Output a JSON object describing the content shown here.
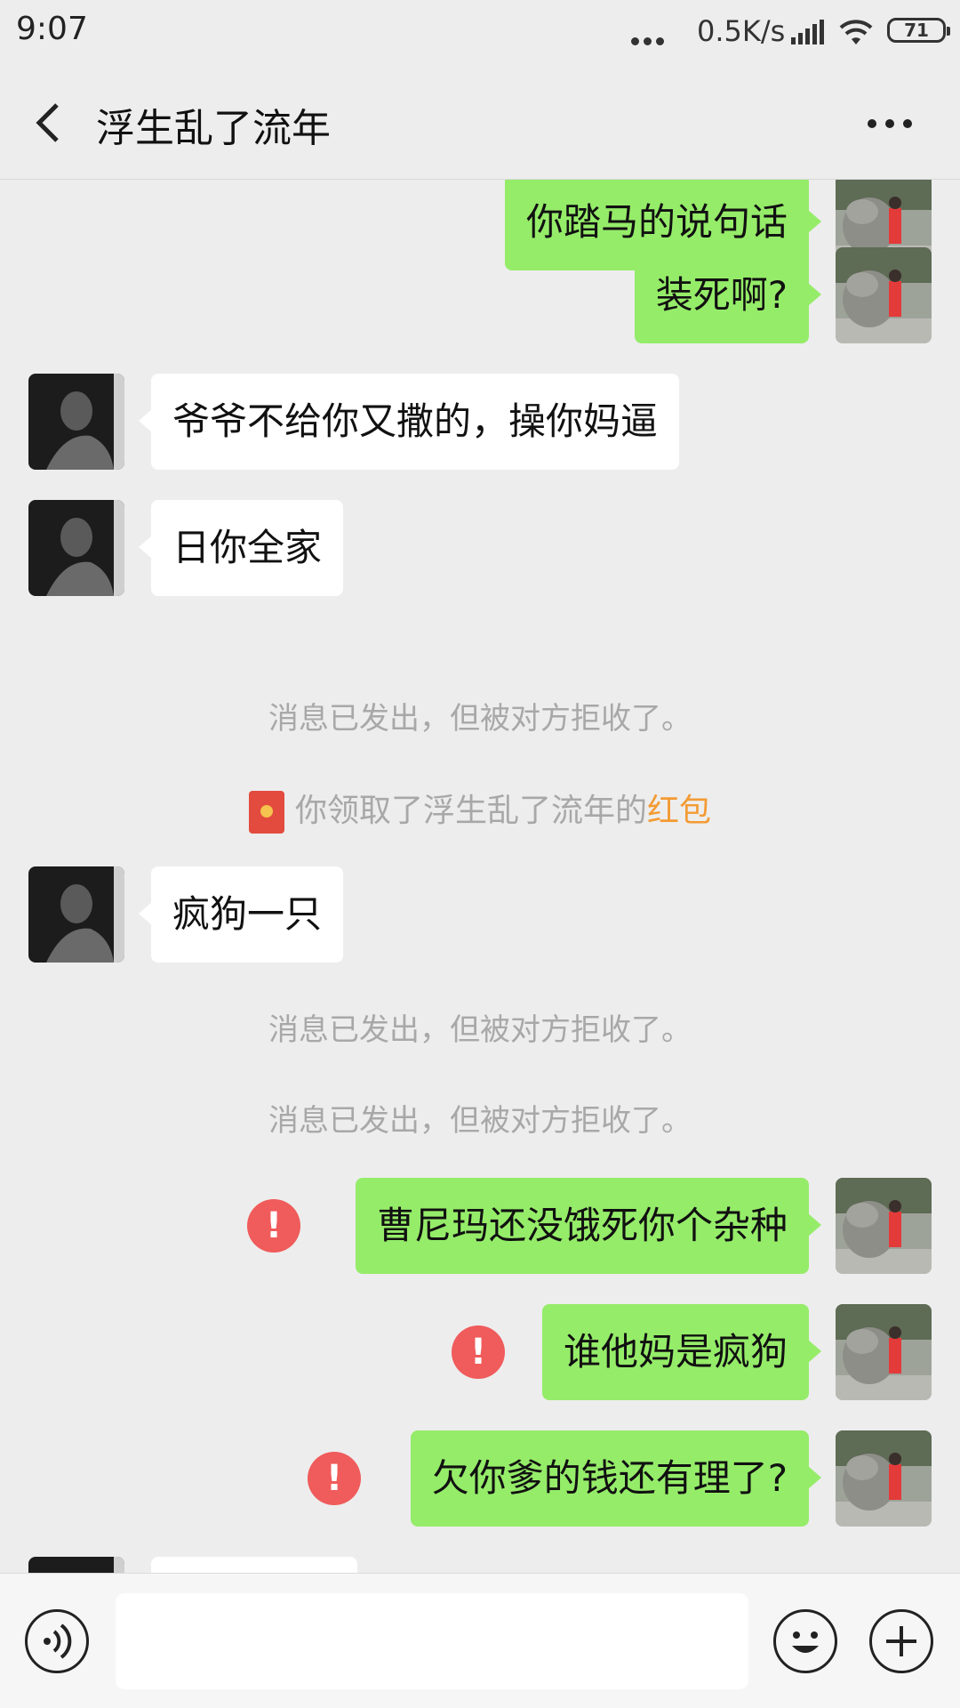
{
  "status_bar": {
    "time": "9:07",
    "network_speed": "0.5K/s",
    "battery": "71",
    "icons": [
      "more-dots-icon",
      "signal-icon",
      "wifi-icon",
      "battery-icon"
    ]
  },
  "header": {
    "title": "浮生乱了流年",
    "back_icon": "back-chevron-icon",
    "more_icon": "more-icon"
  },
  "messages": [
    {
      "side": "right",
      "text": "你踏马的说句话"
    },
    {
      "side": "right",
      "text": "装死啊?"
    },
    {
      "side": "left",
      "text": "爷爷不给你又撒的，操你妈逼"
    },
    {
      "side": "left",
      "text": "日你全家"
    },
    {
      "system": "消息已发出，但被对方拒收了。"
    },
    {
      "red_packet_prefix": "你领取了浮生乱了流年的",
      "red_packet_link": "红包"
    },
    {
      "side": "left",
      "text": "疯狗一只"
    },
    {
      "system": "消息已发出，但被对方拒收了。"
    },
    {
      "system": "消息已发出，但被对方拒收了。"
    },
    {
      "side": "right",
      "text": "曹尼玛还没饿死你个杂种",
      "failed": true
    },
    {
      "side": "right",
      "text": "谁他妈是疯狗",
      "failed": true
    },
    {
      "side": "right",
      "text": "欠你爹的钱还有理了?",
      "failed": true
    }
  ],
  "error_glyph": "!",
  "input_bar": {
    "placeholder": "",
    "icons": [
      "voice-icon",
      "emoji-icon",
      "plus-icon"
    ]
  },
  "colors": {
    "background": "#ededed",
    "sent_bubble": "#95ec69",
    "received_bubble": "#ffffff",
    "error": "#f05b5b",
    "red_packet_link": "#f39b34"
  }
}
